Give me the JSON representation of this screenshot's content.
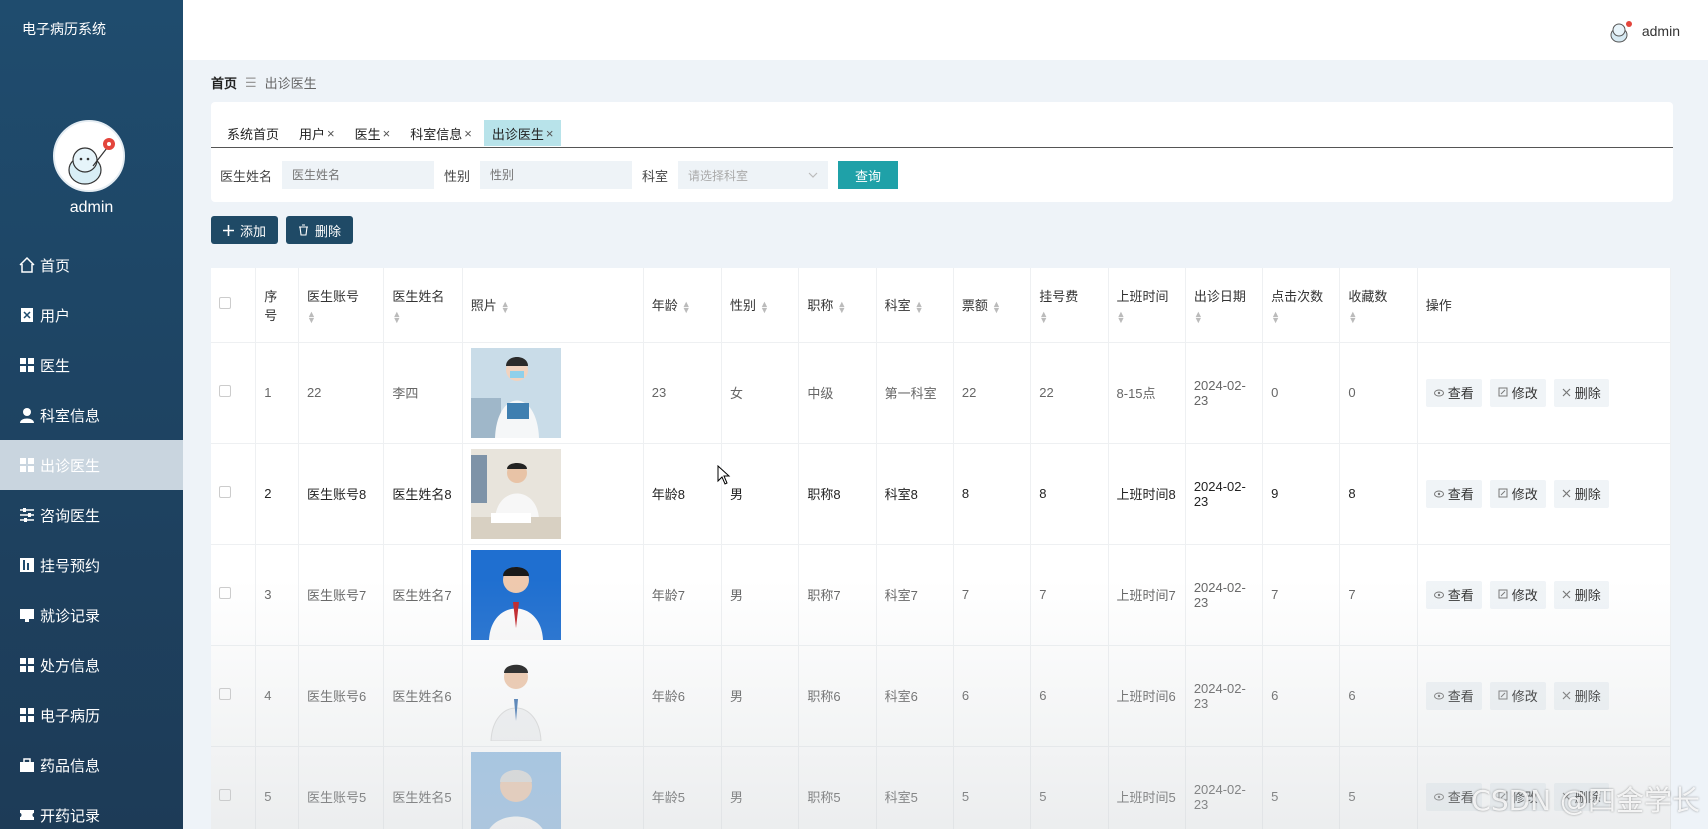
{
  "app": {
    "title": "电子病历系统"
  },
  "sidebar": {
    "username": "admin",
    "items": [
      {
        "label": "首页",
        "icon": "home-icon"
      },
      {
        "label": "用户",
        "icon": "user-file-icon"
      },
      {
        "label": "医生",
        "icon": "grid-icon"
      },
      {
        "label": "科室信息",
        "icon": "person-icon"
      },
      {
        "label": "出诊医生",
        "icon": "grid-icon",
        "active": true
      },
      {
        "label": "咨询医生",
        "icon": "sliders-icon"
      },
      {
        "label": "挂号预约",
        "icon": "bar-icon"
      },
      {
        "label": "就诊记录",
        "icon": "monitor-icon"
      },
      {
        "label": "处方信息",
        "icon": "grid-icon"
      },
      {
        "label": "电子病历",
        "icon": "grid-icon"
      },
      {
        "label": "药品信息",
        "icon": "bag-icon"
      },
      {
        "label": "开药记录",
        "icon": "ticket-icon"
      }
    ]
  },
  "topbar": {
    "username": "admin"
  },
  "breadcrumb": {
    "home": "首页",
    "sep": "☰",
    "current": "出诊医生"
  },
  "tabs": [
    {
      "label": "系统首页",
      "closable": false
    },
    {
      "label": "用户",
      "closable": true
    },
    {
      "label": "医生",
      "closable": true
    },
    {
      "label": "科室信息",
      "closable": true
    },
    {
      "label": "出诊医生",
      "closable": true,
      "active": true
    }
  ],
  "search": {
    "name_label": "医生姓名",
    "name_placeholder": "医生姓名",
    "gender_label": "性别",
    "gender_placeholder": "性别",
    "dept_label": "科室",
    "dept_placeholder": "请选择科室",
    "query_button": "查询"
  },
  "actions": {
    "add": "添加",
    "delete": "删除"
  },
  "table": {
    "columns": [
      {
        "label": "序号",
        "sort": false
      },
      {
        "label": "医生账号",
        "sort": true
      },
      {
        "label": "医生姓名",
        "sort": true
      },
      {
        "label": "照片",
        "sort": true
      },
      {
        "label": "年龄",
        "sort": true
      },
      {
        "label": "性别",
        "sort": true
      },
      {
        "label": "职称",
        "sort": true
      },
      {
        "label": "科室",
        "sort": true
      },
      {
        "label": "票额",
        "sort": true
      },
      {
        "label": "挂号费",
        "sort": true
      },
      {
        "label": "上班时间",
        "sort": true
      },
      {
        "label": "出诊日期",
        "sort": true
      },
      {
        "label": "点击次数",
        "sort": true
      },
      {
        "label": "收藏数",
        "sort": true
      },
      {
        "label": "操作",
        "sort": false
      }
    ],
    "rows": [
      {
        "no": "1",
        "account": "22",
        "name": "李四",
        "photo": "female-doctor",
        "age": "23",
        "gender": "女",
        "title": "中级",
        "dept": "第一科室",
        "ticket": "22",
        "fee": "22",
        "hours": "8-15点",
        "date": "2024-02-23",
        "clicks": "0",
        "favs": "0",
        "dark": false
      },
      {
        "no": "2",
        "account": "医生账号8",
        "name": "医生姓名8",
        "photo": "male-doctor-desk",
        "age": "年龄8",
        "gender": "男",
        "title": "职称8",
        "dept": "科室8",
        "ticket": "8",
        "fee": "8",
        "hours": "上班时间8",
        "date": "2024-02-23",
        "clicks": "9",
        "favs": "8",
        "dark": true
      },
      {
        "no": "3",
        "account": "医生账号7",
        "name": "医生姓名7",
        "photo": "male-doctor-blue",
        "age": "年龄7",
        "gender": "男",
        "title": "职称7",
        "dept": "科室7",
        "ticket": "7",
        "fee": "7",
        "hours": "上班时间7",
        "date": "2024-02-23",
        "clicks": "7",
        "favs": "7",
        "dark": false
      },
      {
        "no": "4",
        "account": "医生账号6",
        "name": "医生姓名6",
        "photo": "male-doctor-white",
        "age": "年龄6",
        "gender": "男",
        "title": "职称6",
        "dept": "科室6",
        "ticket": "6",
        "fee": "6",
        "hours": "上班时间6",
        "date": "2024-02-23",
        "clicks": "6",
        "favs": "6",
        "dark": false
      },
      {
        "no": "5",
        "account": "医生账号5",
        "name": "医生姓名5",
        "photo": "older-male-doctor",
        "age": "年龄5",
        "gender": "男",
        "title": "职称5",
        "dept": "科室5",
        "ticket": "5",
        "fee": "5",
        "hours": "上班时间5",
        "date": "2024-02-23",
        "clicks": "5",
        "favs": "5",
        "dark": false
      }
    ],
    "row_ops": {
      "view": "查看",
      "edit": "修改",
      "delete": "删除"
    }
  },
  "watermark": "CSDN @四金学长",
  "colors": {
    "sidebar": "#1f4c6e",
    "accent": "#1fa1a8",
    "button": "#1f4a66",
    "active_tab": "#b8e3ea"
  }
}
